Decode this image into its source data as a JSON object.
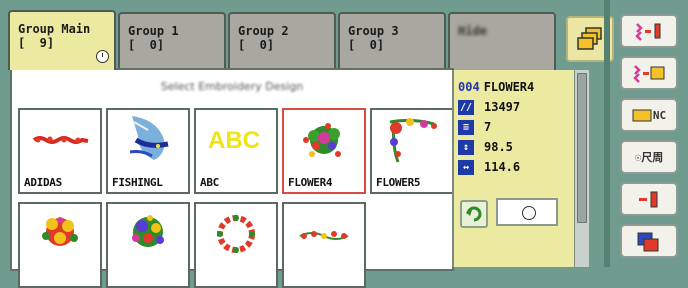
{
  "tabs": [
    {
      "line1": "Group Main",
      "line2": "[  9]",
      "active": true
    },
    {
      "line1": "Group 1",
      "line2": "[  0]",
      "active": false
    },
    {
      "line1": "Group 2",
      "line2": "[  0]",
      "active": false
    },
    {
      "line1": "Group 3",
      "line2": "[  0]",
      "active": false
    },
    {
      "line1": "Hide",
      "line2": "",
      "active": false
    }
  ],
  "content": {
    "title": "Select Embroidery Design",
    "thumbnails": [
      {
        "name": "ADIDAS"
      },
      {
        "name": "FISHINGL"
      },
      {
        "name": "ABC"
      },
      {
        "name": "FLOWER4",
        "selected": true
      },
      {
        "name": "FLOWER5"
      },
      {
        "name": ""
      },
      {
        "name": ""
      },
      {
        "name": ""
      },
      {
        "name": ""
      }
    ]
  },
  "info": {
    "design_number": "004",
    "design_name": "FLOWER4",
    "stitches": "13497",
    "colors": "7",
    "height": "98.5",
    "width": "114.6"
  },
  "toolbar": {
    "load_label": "",
    "folder_label": "",
    "net_label": "NC",
    "clock_label": "☉尺周",
    "icons": [
      "load-from-machine-icon",
      "load-from-folder-icon",
      "network-folder-icon",
      "clock-schedule-icon",
      "send-to-machine-icon",
      "copy-icon"
    ]
  },
  "colors": {
    "tab_active": "#ece9a0",
    "tab_inactive": "#a8a8a0",
    "selected_border": "#d94a42",
    "background": "#6f9c8f"
  }
}
